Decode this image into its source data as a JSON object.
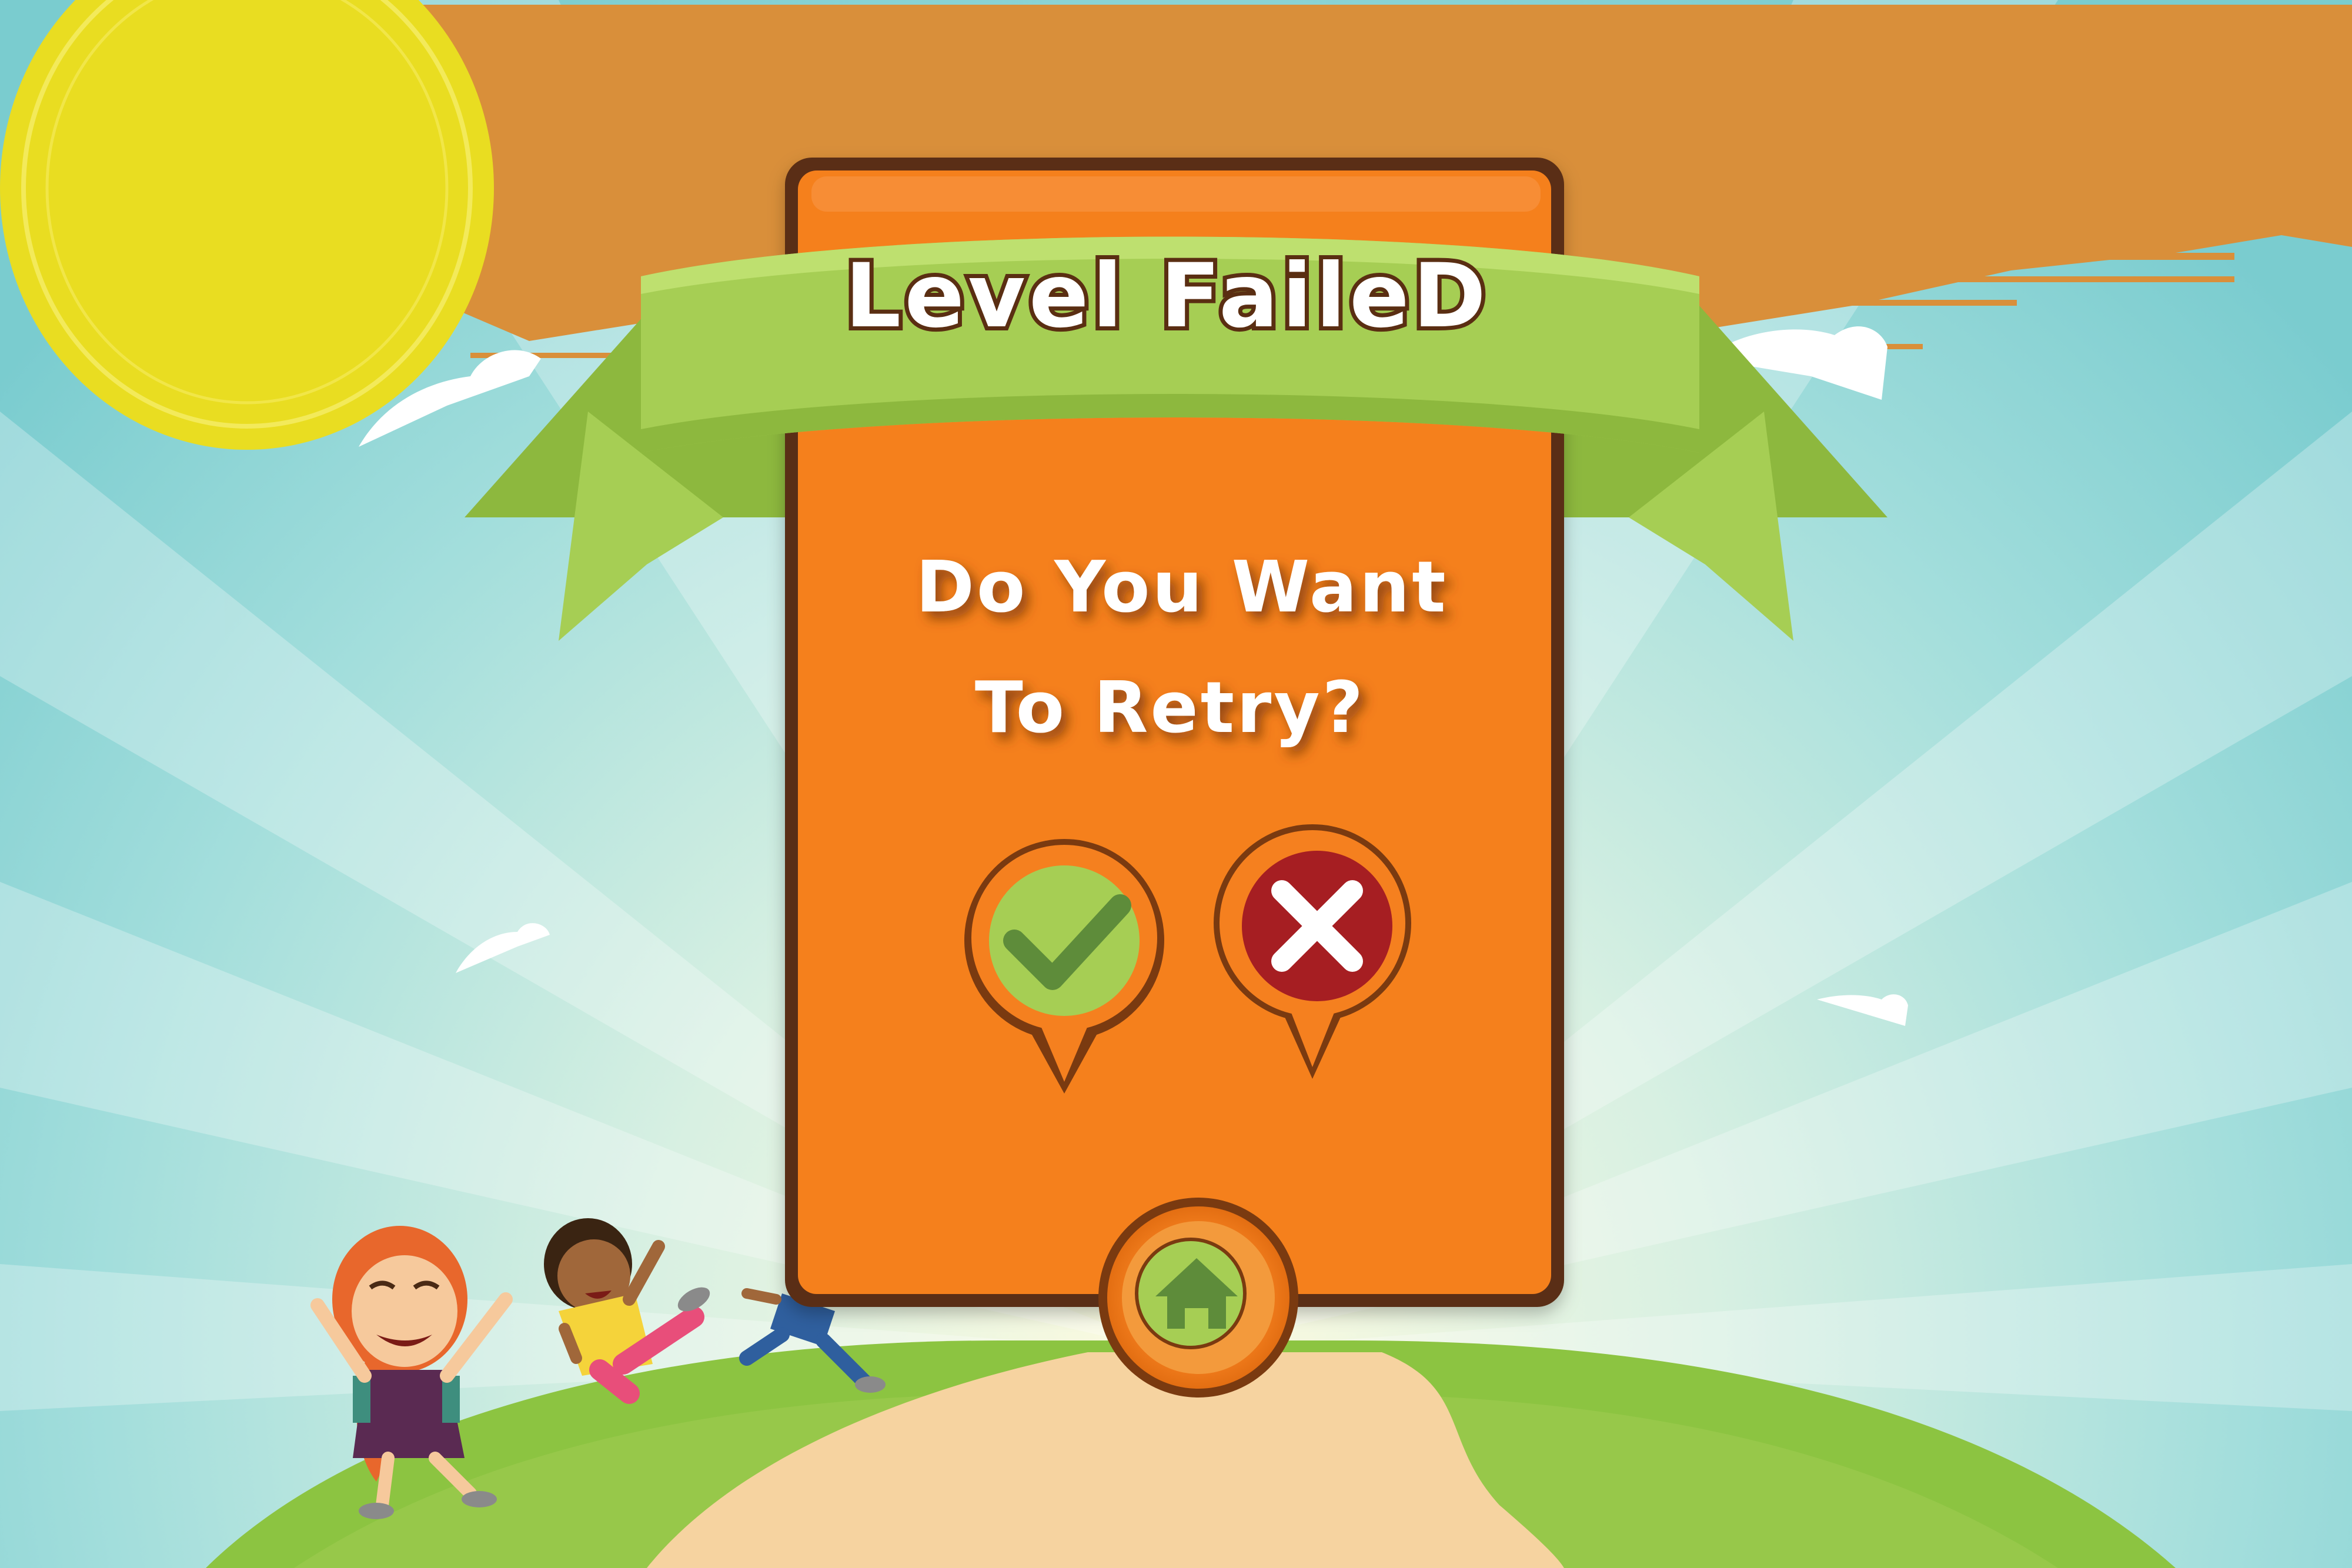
{
  "dialog": {
    "title": "Level FaileD",
    "message_line1": "Do You Want",
    "message_line2": "To Retry?"
  },
  "buttons": {
    "confirm_icon": "checkmark-icon",
    "cancel_icon": "close-icon",
    "home_icon": "home-icon"
  },
  "colors": {
    "panel": "#F5801F",
    "panel_border": "#5A2E12",
    "ribbon": "#A6CE54",
    "confirm": "#A6CE54",
    "cancel": "#A61E22",
    "sky": "#7ACCCF",
    "sun": "#E9DD21",
    "sky_paint": "#D98F3A",
    "grass": "#8CC441",
    "path": "#F6D3A0"
  }
}
